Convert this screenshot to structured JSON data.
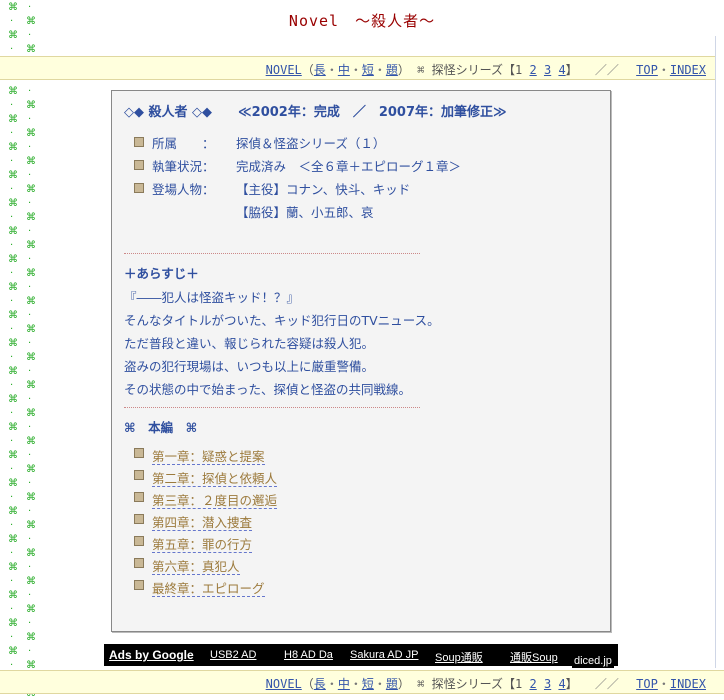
{
  "page": {
    "title": "Novel　～殺人者～"
  },
  "nav": {
    "novel": "NOVEL",
    "open_paren": "（",
    "long": "長",
    "middle": "中",
    "short": "短",
    "topic": "題",
    "close_paren": "）",
    "series_mark": "⌘",
    "series_label": "探怪シリーズ【1",
    "p2": "2",
    "p3": "3",
    "p4": "4",
    "close_bracket": "】",
    "slashes": "／／",
    "top": "TOP",
    "dot": "・",
    "index": "INDEX"
  },
  "card": {
    "heading": "◇◆ 殺人者 ◇◆",
    "years": "≪2002年：完成　／　2007年：加筆修正≫",
    "meta": [
      {
        "label": "所属　　：",
        "value": "探偵＆怪盗シリーズ（１）"
      },
      {
        "label": "執筆状況：",
        "value": "完成済み　＜全６章＋エピローグ１章＞"
      },
      {
        "label": "登場人物：",
        "value": "【主役】コナン、快斗、キッド"
      },
      {
        "label": "",
        "value": "【脇役】蘭、小五郎、哀"
      }
    ],
    "synopsis_title": "＋あらすじ＋",
    "synopsis": [
      "『――犯人は怪盗キッド！？』",
      "そんなタイトルがついた、キッド犯行日のTVニュース。",
      "ただ普段と違い、報じられた容疑は殺人犯。",
      "盗みの犯行現場は、いつも以上に厳重警備。",
      "その状態の中で始まった、探偵と怪盗の共同戦線。"
    ],
    "chapters_title": "⌘　本編　⌘",
    "chapters": [
      "第一章：疑惑と提案",
      "第二章：探偵と依頼人",
      "第三章：２度目の邂逅",
      "第四章：潜入捜査",
      "第五章：罪の行方",
      "第六章：真犯人",
      "最終章：エピローグ"
    ]
  },
  "ads": {
    "title": "Ads by Google",
    "items": [
      "USB2 AD",
      "H8 AD Da",
      "Sakura AD JP",
      "Soup通販",
      "通販Soup"
    ],
    "diced": "diced.jp"
  },
  "colors": {
    "title": "#990000",
    "nav_bg": "#ffffdd",
    "link": "#3355aa",
    "card_text": "#2f4f9f",
    "chapter_link": "#9c7a3c",
    "pattern": "#22aa22"
  }
}
